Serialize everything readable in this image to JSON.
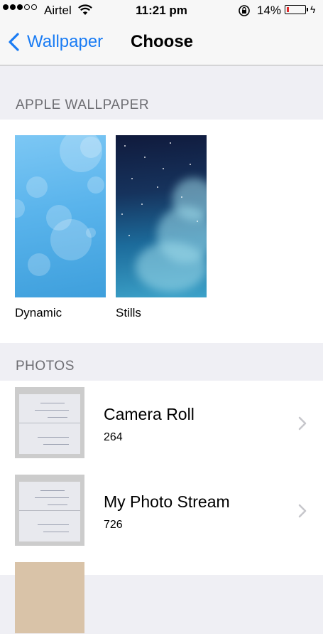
{
  "status_bar": {
    "carrier": "Airtel",
    "time": "11:21 pm",
    "battery_percent": "14%",
    "battery_level": 0.14,
    "signal_filled": 3,
    "signal_empty": 2
  },
  "nav": {
    "back_label": "Wallpaper",
    "title": "Choose"
  },
  "apple_wallpaper": {
    "header": "APPLE WALLPAPER",
    "items": [
      {
        "label": "Dynamic"
      },
      {
        "label": "Stills"
      }
    ]
  },
  "photos": {
    "header": "PHOTOS",
    "albums": [
      {
        "name": "Camera Roll",
        "count": "264"
      },
      {
        "name": "My Photo Stream",
        "count": "726"
      }
    ]
  },
  "colors": {
    "accent": "#1a7cf4",
    "battery_low": "#e12a2a",
    "background": "#efeff4"
  }
}
